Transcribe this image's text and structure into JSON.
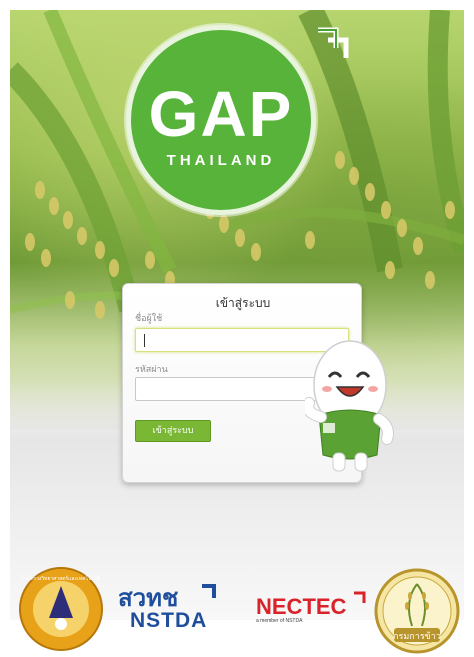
{
  "logo": {
    "main": "GAP",
    "sub": "THAILAND"
  },
  "login": {
    "title": "เข้าสู่ระบบ",
    "username_label": "ชื่อผู้ใช้",
    "username_value": "",
    "password_label": "รหัสผ่าน",
    "password_value": "",
    "submit_label": "เข้าสู่ระบบ"
  },
  "footer_logos": {
    "most": "กระทรวงวิทยาศาสตร์และเทคโนโลยี",
    "nstda_thai": "สวทช",
    "nstda": "NSTDA",
    "nectec": "NECTEC",
    "nectec_tagline": "a member of NSTDA",
    "rice_dept": "กรมการข้าว"
  },
  "colors": {
    "brand_green": "#58b33a",
    "button_green": "#7ab734",
    "nstda_blue": "#1f4f9c",
    "nectec_red": "#d8232a"
  }
}
